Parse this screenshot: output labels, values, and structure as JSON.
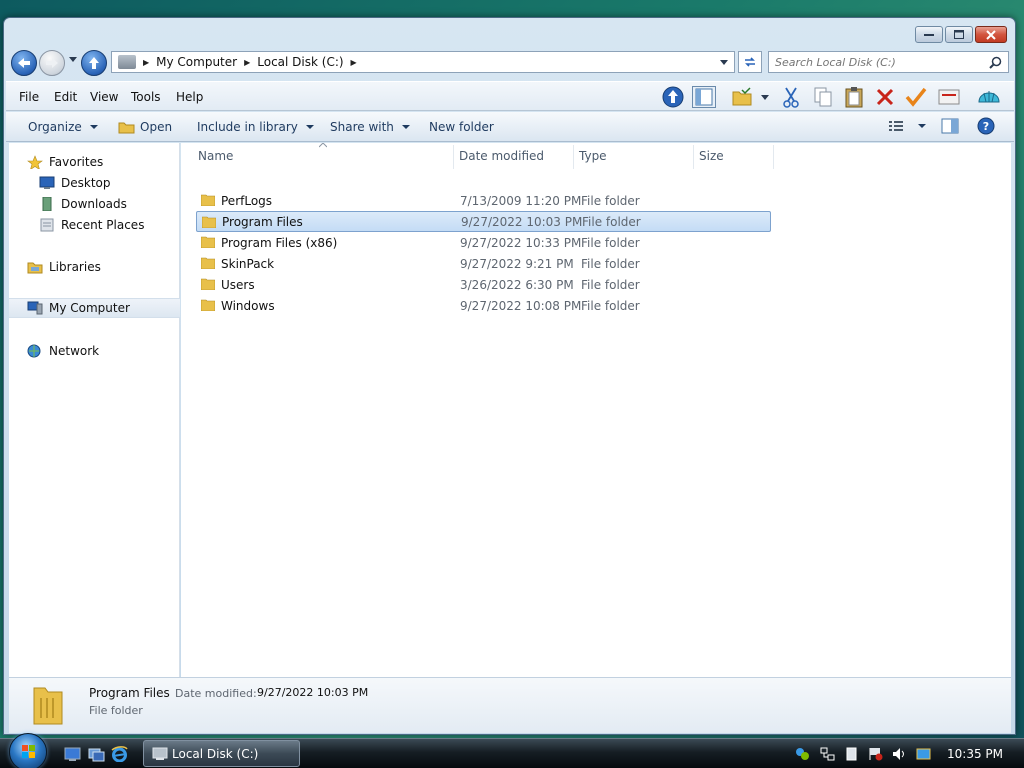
{
  "window": {
    "address": {
      "crumbs": [
        "My Computer",
        "Local Disk (C:)"
      ]
    },
    "search": {
      "placeholder": "Search Local Disk (C:)"
    },
    "menu": [
      "File",
      "Edit",
      "View",
      "Tools",
      "Help"
    ],
    "commands": {
      "organize": "Organize",
      "open": "Open",
      "include_in_library": "Include in library",
      "share_with": "Share with",
      "new_folder": "New folder"
    },
    "nav": {
      "favorites": "Favorites",
      "desktop": "Desktop",
      "downloads": "Downloads",
      "recent_places": "Recent Places",
      "libraries": "Libraries",
      "my_computer": "My Computer",
      "network": "Network"
    },
    "columns": {
      "name": "Name",
      "date_modified": "Date modified",
      "type": "Type",
      "size": "Size"
    },
    "files": [
      {
        "name": "PerfLogs",
        "date": "7/13/2009 11:20 PM",
        "type": "File folder"
      },
      {
        "name": "Program Files",
        "date": "9/27/2022 10:03 PM",
        "type": "File folder"
      },
      {
        "name": "Program Files (x86)",
        "date": "9/27/2022 10:33 PM",
        "type": "File folder"
      },
      {
        "name": "SkinPack",
        "date": "9/27/2022 9:21 PM",
        "type": "File folder"
      },
      {
        "name": "Users",
        "date": "3/26/2022 6:30 PM",
        "type": "File folder"
      },
      {
        "name": "Windows",
        "date": "9/27/2022 10:08 PM",
        "type": "File folder"
      }
    ],
    "selected_index": 1,
    "details": {
      "name": "Program Files",
      "date_label": "Date modified:",
      "date": "9/27/2022 10:03 PM",
      "type": "File folder"
    }
  },
  "taskbar": {
    "task_label": "Local Disk (C:)",
    "clock": "10:35 PM"
  },
  "colors": {
    "selection": "#c4dcf5",
    "selection_border": "#7da2ce",
    "folder": "#e8c04a"
  }
}
